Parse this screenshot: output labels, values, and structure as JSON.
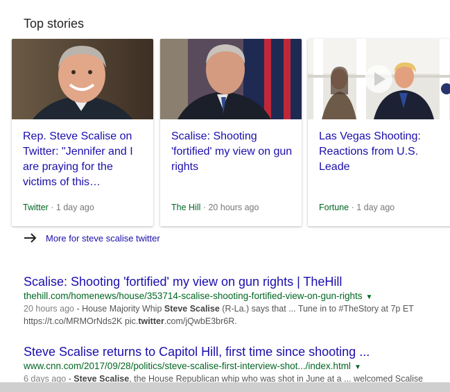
{
  "section": {
    "title": "Top stories"
  },
  "stories": [
    {
      "headline": "Rep. Steve Scalise on Twitter: \"Jennifer and I are praying for the victims of this…",
      "source": "Twitter",
      "sep": " · ",
      "age": "1 day ago"
    },
    {
      "headline": "Scalise: Shooting 'fortified' my view on gun rights",
      "source": "The Hill",
      "sep": " · ",
      "age": "20 hours ago"
    },
    {
      "headline": "Las Vegas Shooting: Reactions from U.S. Leade",
      "source": "Fortune",
      "sep": " · ",
      "age": "1 day ago"
    }
  ],
  "more": {
    "label": "More for steve scalise twitter"
  },
  "results": [
    {
      "title": "Scalise: Shooting 'fortified' my view on gun rights | TheHill",
      "url": "thehill.com/homenews/house/353714-scalise-shooting-fortified-view-on-gun-rights",
      "date": "20 hours ago",
      "s1a": " - House Majority Whip ",
      "s1b": "Steve Scalise",
      "s1c": " (R-La.) says that ... Tune in to #TheStory at 7p ET",
      "s2a": "https://t.co/MRMOrNds2K pic.",
      "s2b": "twitter",
      "s2c": ".com/jQwbE3br6R."
    },
    {
      "title": "Steve Scalise returns to Capitol Hill, first time since shooting ...",
      "url": "www.cnn.com/2017/09/28/politics/steve-scalise-first-interview-shot.../index.html",
      "date": "6 days ago",
      "s1a": " - ",
      "s1b": "Steve Scalise",
      "s1c": ", the House Republican whip who was shot in June at a ... welcomed Scalise"
    }
  ],
  "colors": {
    "link": "#1a0dab",
    "url": "#006621",
    "snippet": "#545454"
  }
}
